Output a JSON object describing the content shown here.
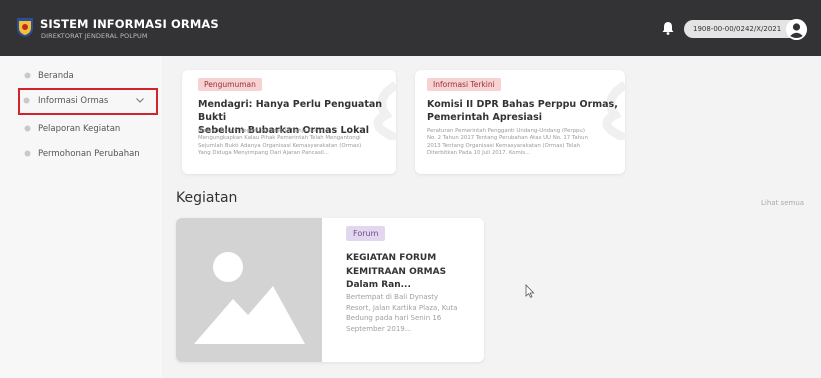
{
  "header": {
    "title": "SISTEM INFORMASI ORMAS",
    "subtitle": "DIREKTORAT JENDERAL POLPUM",
    "user_id": "1908-00-00/0242/X/2021",
    "bg_color": "#333335"
  },
  "sidebar": {
    "items": [
      {
        "label": "Beranda",
        "icon": "dot-icon"
      },
      {
        "label": "Informasi Ormas",
        "icon": "dot-icon",
        "highlighted": true
      },
      {
        "label": "Pelaporan Kegiatan",
        "icon": "dot-icon"
      },
      {
        "label": "Permohonan Perubahan",
        "icon": "dot-icon"
      }
    ],
    "highlight_color": "#d0242f"
  },
  "news": [
    {
      "badge": "Pengumuman",
      "title_line1": "Mendagri: Hanya Perlu Penguatan Bukti",
      "title_line2": "Sebelum Bubarkan Ormas Lokal",
      "body_lines": [
        "Menteri Dalam Negeri (Mendagri) Tjahjo Kumolo",
        "Mengungkapkan Kalau Pihak Pemerintah Telah Mengantongi",
        "Sejumlah Bukti Adanya Organisasi Kemasyarakatan (Ormas)",
        "Yang Diduga Menyimpang Dari Ajaran Pancasil..."
      ]
    },
    {
      "badge": "Informasi Terkini",
      "title_line1": "Komisi II DPR Bahas Perppu Ormas,",
      "title_line2": "Pemerintah Apresiasi",
      "body_lines": [
        "Peraturan Pemerintah Pengganti Undang-Undang (Perppu)",
        "No. 2 Tahun 2017 Tentang Perubahan Atas UU No. 17 Tahun",
        "2013 Tentang Organisasi Kemasyarakatan (Ormas) Telah",
        "Diterbitkan Pada 10 Juli 2017. Komis..."
      ]
    }
  ],
  "kegiatan": {
    "section_title": "Kegiatan",
    "see_all": "Lihat semua",
    "event": {
      "badge": "Forum",
      "title_lines": [
        "KEGIATAN FORUM",
        "KEMITRAAN ORMAS",
        "Dalam Ran..."
      ],
      "desc_lines": [
        "Bertempat di Bali Dynasty",
        "Resort, Jalan Kartika Plaza, Kuta",
        "Bedung pada hari Senin 16",
        "September 2019..."
      ]
    }
  }
}
